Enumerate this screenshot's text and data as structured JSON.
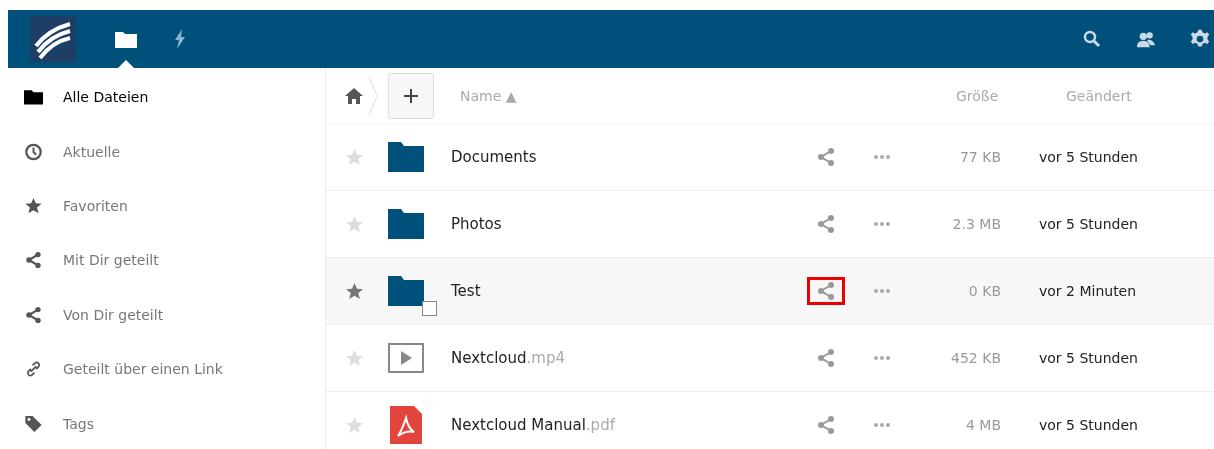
{
  "header": {
    "apps": [
      {
        "kind": "files",
        "selected": true
      },
      {
        "kind": "activity",
        "selected": false
      }
    ]
  },
  "sidebar": {
    "items": [
      {
        "label": "Alle Dateien",
        "kind": "folder",
        "selected": true
      },
      {
        "label": "Aktuelle",
        "kind": "clock",
        "selected": false
      },
      {
        "label": "Favoriten",
        "kind": "star",
        "selected": false
      },
      {
        "label": "Mit Dir geteilt",
        "kind": "share",
        "selected": false
      },
      {
        "label": "Von Dir geteilt",
        "kind": "share",
        "selected": false
      },
      {
        "label": "Geteilt über einen Link",
        "kind": "link",
        "selected": false
      },
      {
        "label": "Tags",
        "kind": "tag",
        "selected": false
      }
    ]
  },
  "table": {
    "columns": [
      "Name",
      "Größe",
      "Geändert"
    ],
    "sort_indicator": "▲",
    "rows": [
      {
        "name": "Documents",
        "ext": "",
        "kind": "folder",
        "size": "77 KB",
        "modified": "vor 5 Stunden",
        "hovered": false,
        "share_marked": false
      },
      {
        "name": "Photos",
        "ext": "",
        "kind": "folder",
        "size": "2.3 MB",
        "modified": "vor 5 Stunden",
        "hovered": false,
        "share_marked": false
      },
      {
        "name": "Test",
        "ext": "",
        "kind": "folder",
        "size": "0 KB",
        "modified": "vor 2 Minuten",
        "hovered": true,
        "share_marked": true
      },
      {
        "name": "Nextcloud",
        "ext": ".mp4",
        "kind": "video",
        "size": "452 KB",
        "modified": "vor 5 Stunden",
        "hovered": false,
        "share_marked": false
      },
      {
        "name": "Nextcloud Manual",
        "ext": ".pdf",
        "kind": "pdf",
        "size": "4 MB",
        "modified": "vor 5 Stunden",
        "hovered": false,
        "share_marked": false
      }
    ]
  }
}
